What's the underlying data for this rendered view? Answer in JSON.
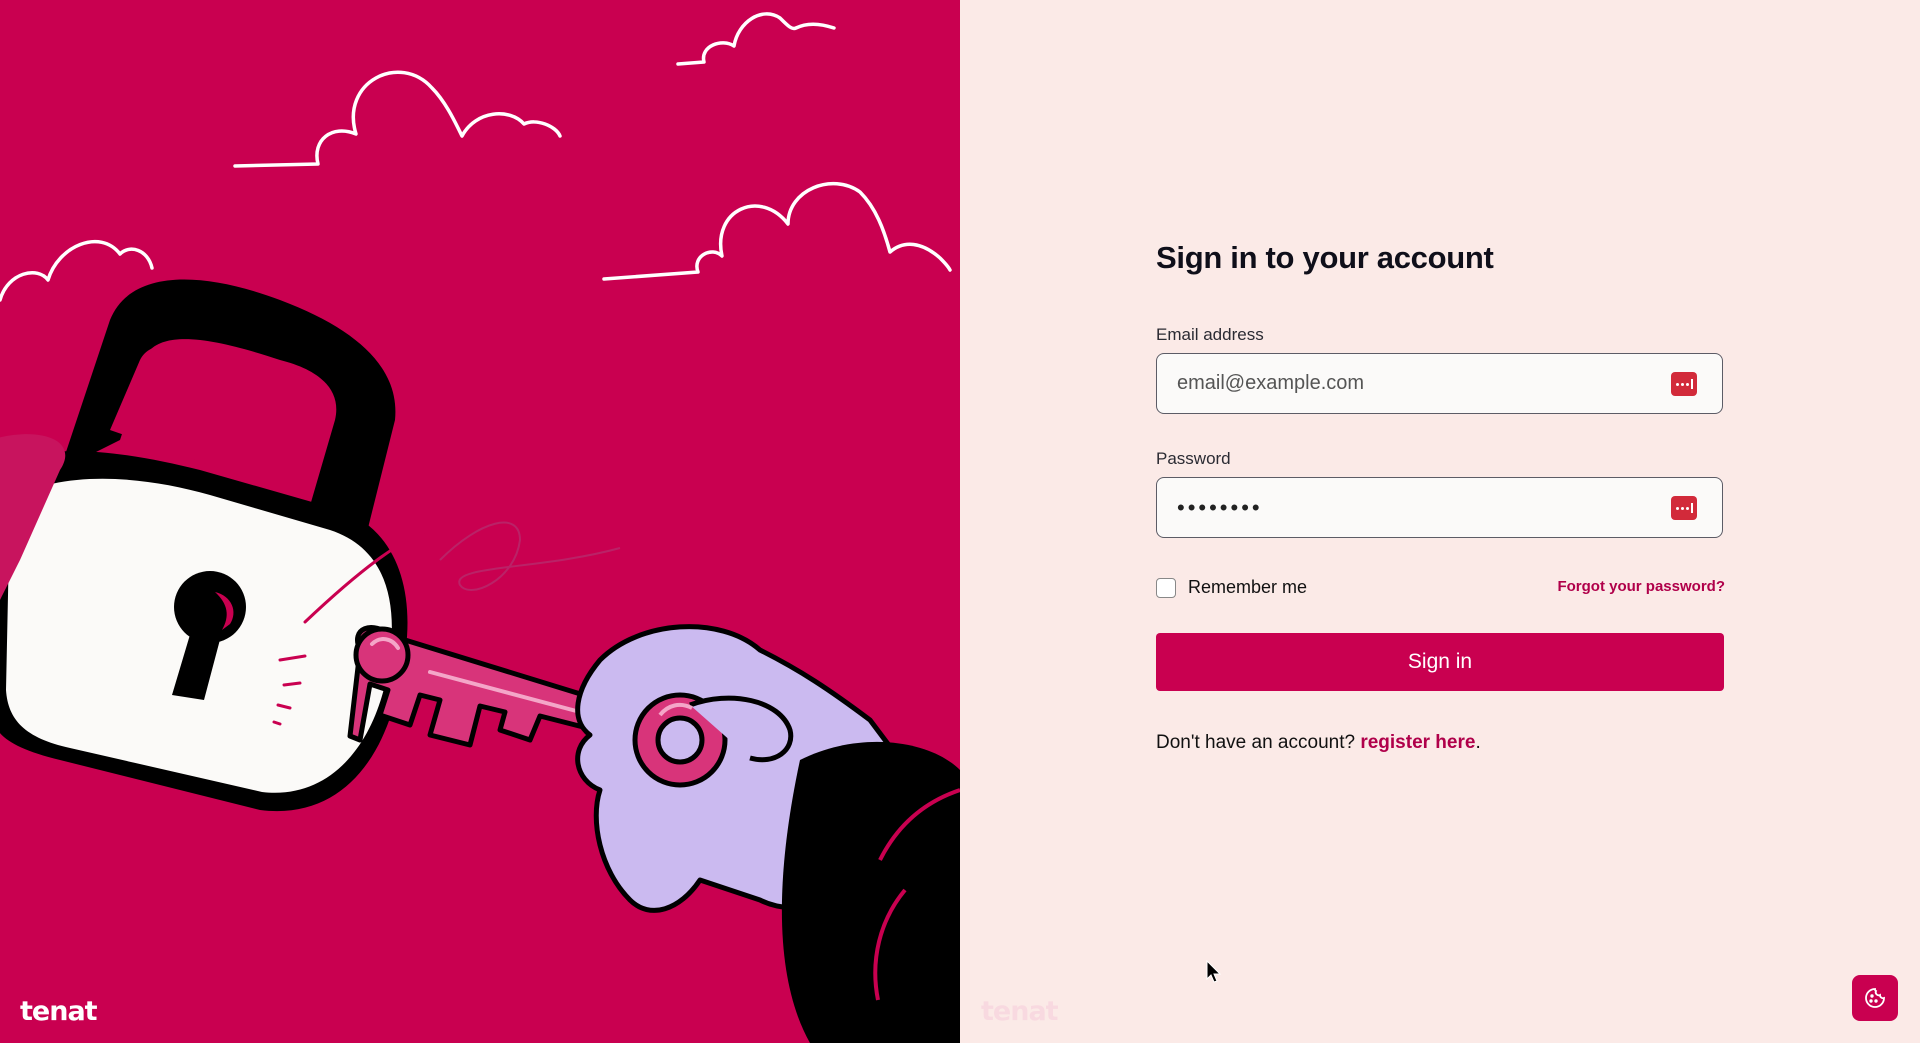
{
  "brand": {
    "name": "tenat"
  },
  "form": {
    "title": "Sign in to your account",
    "email_label": "Email address",
    "email_placeholder": "email@example.com",
    "email_value": "",
    "password_label": "Password",
    "password_value": "••••••••",
    "remember_label": "Remember me",
    "remember_checked": false,
    "forgot_link": "Forgot your password?",
    "submit_label": "Sign in",
    "register_prompt": "Don't have an account?",
    "register_link": "register here",
    "register_suffix": "."
  },
  "icons": {
    "password_manager": "password-manager-icon",
    "cookie": "cookie-icon"
  },
  "colors": {
    "brand": "#c90050",
    "panel_bg": "#fbeae7",
    "link": "#b0004a",
    "key_icon": "#d22a3a"
  }
}
